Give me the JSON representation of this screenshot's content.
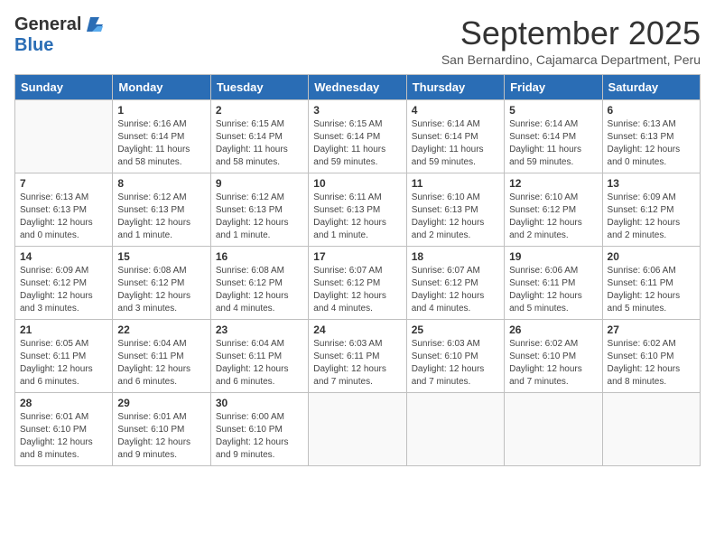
{
  "logo": {
    "general": "General",
    "blue": "Blue"
  },
  "title": "September 2025",
  "subtitle": "San Bernardino, Cajamarca Department, Peru",
  "days_of_week": [
    "Sunday",
    "Monday",
    "Tuesday",
    "Wednesday",
    "Thursday",
    "Friday",
    "Saturday"
  ],
  "weeks": [
    [
      {
        "day": "",
        "sunrise": "",
        "sunset": "",
        "daylight": ""
      },
      {
        "day": "1",
        "sunrise": "Sunrise: 6:16 AM",
        "sunset": "Sunset: 6:14 PM",
        "daylight": "Daylight: 11 hours and 58 minutes."
      },
      {
        "day": "2",
        "sunrise": "Sunrise: 6:15 AM",
        "sunset": "Sunset: 6:14 PM",
        "daylight": "Daylight: 11 hours and 58 minutes."
      },
      {
        "day": "3",
        "sunrise": "Sunrise: 6:15 AM",
        "sunset": "Sunset: 6:14 PM",
        "daylight": "Daylight: 11 hours and 59 minutes."
      },
      {
        "day": "4",
        "sunrise": "Sunrise: 6:14 AM",
        "sunset": "Sunset: 6:14 PM",
        "daylight": "Daylight: 11 hours and 59 minutes."
      },
      {
        "day": "5",
        "sunrise": "Sunrise: 6:14 AM",
        "sunset": "Sunset: 6:14 PM",
        "daylight": "Daylight: 11 hours and 59 minutes."
      },
      {
        "day": "6",
        "sunrise": "Sunrise: 6:13 AM",
        "sunset": "Sunset: 6:13 PM",
        "daylight": "Daylight: 12 hours and 0 minutes."
      }
    ],
    [
      {
        "day": "7",
        "sunrise": "Sunrise: 6:13 AM",
        "sunset": "Sunset: 6:13 PM",
        "daylight": "Daylight: 12 hours and 0 minutes."
      },
      {
        "day": "8",
        "sunrise": "Sunrise: 6:12 AM",
        "sunset": "Sunset: 6:13 PM",
        "daylight": "Daylight: 12 hours and 1 minute."
      },
      {
        "day": "9",
        "sunrise": "Sunrise: 6:12 AM",
        "sunset": "Sunset: 6:13 PM",
        "daylight": "Daylight: 12 hours and 1 minute."
      },
      {
        "day": "10",
        "sunrise": "Sunrise: 6:11 AM",
        "sunset": "Sunset: 6:13 PM",
        "daylight": "Daylight: 12 hours and 1 minute."
      },
      {
        "day": "11",
        "sunrise": "Sunrise: 6:10 AM",
        "sunset": "Sunset: 6:13 PM",
        "daylight": "Daylight: 12 hours and 2 minutes."
      },
      {
        "day": "12",
        "sunrise": "Sunrise: 6:10 AM",
        "sunset": "Sunset: 6:12 PM",
        "daylight": "Daylight: 12 hours and 2 minutes."
      },
      {
        "day": "13",
        "sunrise": "Sunrise: 6:09 AM",
        "sunset": "Sunset: 6:12 PM",
        "daylight": "Daylight: 12 hours and 2 minutes."
      }
    ],
    [
      {
        "day": "14",
        "sunrise": "Sunrise: 6:09 AM",
        "sunset": "Sunset: 6:12 PM",
        "daylight": "Daylight: 12 hours and 3 minutes."
      },
      {
        "day": "15",
        "sunrise": "Sunrise: 6:08 AM",
        "sunset": "Sunset: 6:12 PM",
        "daylight": "Daylight: 12 hours and 3 minutes."
      },
      {
        "day": "16",
        "sunrise": "Sunrise: 6:08 AM",
        "sunset": "Sunset: 6:12 PM",
        "daylight": "Daylight: 12 hours and 4 minutes."
      },
      {
        "day": "17",
        "sunrise": "Sunrise: 6:07 AM",
        "sunset": "Sunset: 6:12 PM",
        "daylight": "Daylight: 12 hours and 4 minutes."
      },
      {
        "day": "18",
        "sunrise": "Sunrise: 6:07 AM",
        "sunset": "Sunset: 6:12 PM",
        "daylight": "Daylight: 12 hours and 4 minutes."
      },
      {
        "day": "19",
        "sunrise": "Sunrise: 6:06 AM",
        "sunset": "Sunset: 6:11 PM",
        "daylight": "Daylight: 12 hours and 5 minutes."
      },
      {
        "day": "20",
        "sunrise": "Sunrise: 6:06 AM",
        "sunset": "Sunset: 6:11 PM",
        "daylight": "Daylight: 12 hours and 5 minutes."
      }
    ],
    [
      {
        "day": "21",
        "sunrise": "Sunrise: 6:05 AM",
        "sunset": "Sunset: 6:11 PM",
        "daylight": "Daylight: 12 hours and 6 minutes."
      },
      {
        "day": "22",
        "sunrise": "Sunrise: 6:04 AM",
        "sunset": "Sunset: 6:11 PM",
        "daylight": "Daylight: 12 hours and 6 minutes."
      },
      {
        "day": "23",
        "sunrise": "Sunrise: 6:04 AM",
        "sunset": "Sunset: 6:11 PM",
        "daylight": "Daylight: 12 hours and 6 minutes."
      },
      {
        "day": "24",
        "sunrise": "Sunrise: 6:03 AM",
        "sunset": "Sunset: 6:11 PM",
        "daylight": "Daylight: 12 hours and 7 minutes."
      },
      {
        "day": "25",
        "sunrise": "Sunrise: 6:03 AM",
        "sunset": "Sunset: 6:10 PM",
        "daylight": "Daylight: 12 hours and 7 minutes."
      },
      {
        "day": "26",
        "sunrise": "Sunrise: 6:02 AM",
        "sunset": "Sunset: 6:10 PM",
        "daylight": "Daylight: 12 hours and 7 minutes."
      },
      {
        "day": "27",
        "sunrise": "Sunrise: 6:02 AM",
        "sunset": "Sunset: 6:10 PM",
        "daylight": "Daylight: 12 hours and 8 minutes."
      }
    ],
    [
      {
        "day": "28",
        "sunrise": "Sunrise: 6:01 AM",
        "sunset": "Sunset: 6:10 PM",
        "daylight": "Daylight: 12 hours and 8 minutes."
      },
      {
        "day": "29",
        "sunrise": "Sunrise: 6:01 AM",
        "sunset": "Sunset: 6:10 PM",
        "daylight": "Daylight: 12 hours and 9 minutes."
      },
      {
        "day": "30",
        "sunrise": "Sunrise: 6:00 AM",
        "sunset": "Sunset: 6:10 PM",
        "daylight": "Daylight: 12 hours and 9 minutes."
      },
      {
        "day": "",
        "sunrise": "",
        "sunset": "",
        "daylight": ""
      },
      {
        "day": "",
        "sunrise": "",
        "sunset": "",
        "daylight": ""
      },
      {
        "day": "",
        "sunrise": "",
        "sunset": "",
        "daylight": ""
      },
      {
        "day": "",
        "sunrise": "",
        "sunset": "",
        "daylight": ""
      }
    ]
  ]
}
